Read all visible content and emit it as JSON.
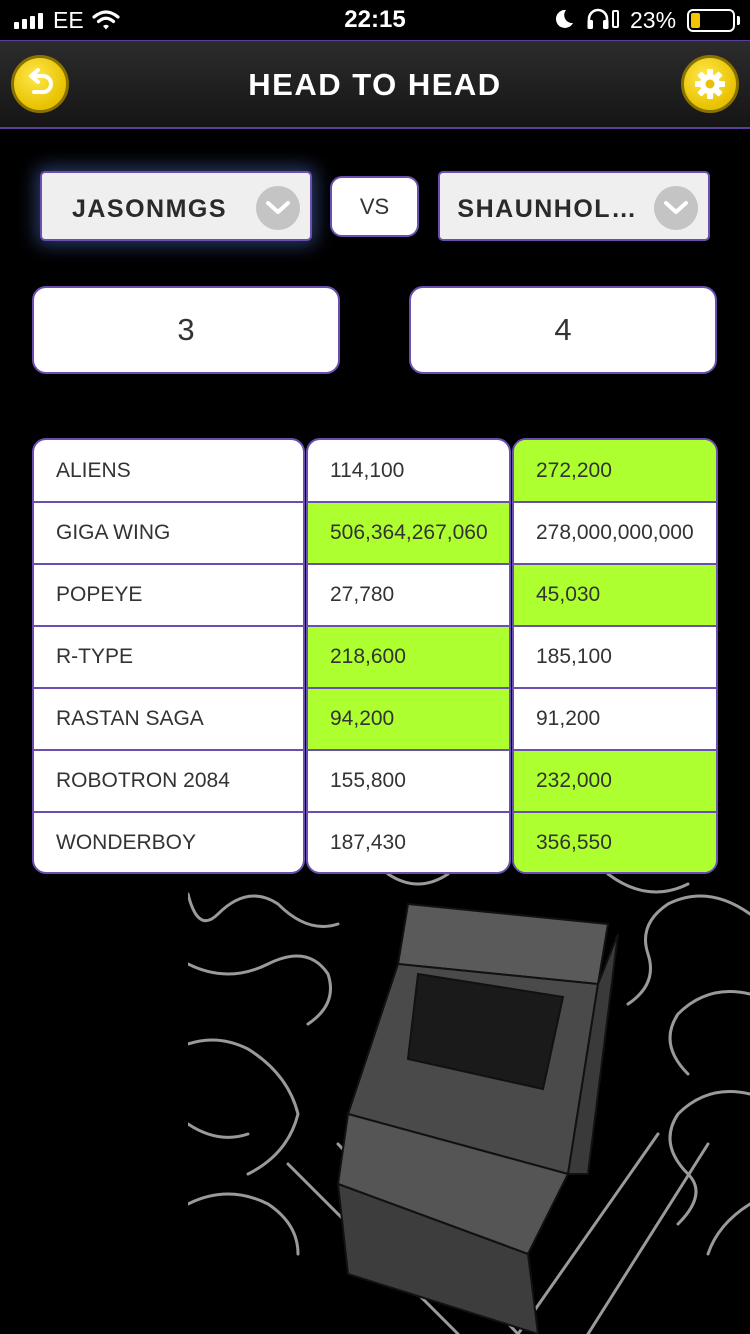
{
  "status_bar": {
    "carrier": "EE",
    "time": "22:15",
    "battery_percent_text": "23%",
    "battery_level": 0.23,
    "battery_color": "#f5c400"
  },
  "header": {
    "title": "HEAD TO HEAD",
    "back_icon": "undo-arrow-icon",
    "settings_icon": "gear-icon",
    "accent_color": "#f0d000"
  },
  "players": {
    "left": {
      "name": "JASONMGS",
      "wins": "3"
    },
    "vs_label": "VS",
    "right": {
      "name": "SHAUNHOL…",
      "wins": "4"
    }
  },
  "comparison": {
    "win_color": "#adff2f",
    "rows": [
      {
        "game": "ALIENS",
        "p1": "114,100",
        "p2": "272,200",
        "winner": "p2"
      },
      {
        "game": "GIGA WING",
        "p1": "506,364,267,060",
        "p2": "278,000,000,000",
        "winner": "p1"
      },
      {
        "game": "POPEYE",
        "p1": "27,780",
        "p2": "45,030",
        "winner": "p2"
      },
      {
        "game": "R-TYPE",
        "p1": "218,600",
        "p2": "185,100",
        "winner": "p1"
      },
      {
        "game": "RASTAN SAGA",
        "p1": "94,200",
        "p2": "91,200",
        "winner": "p1"
      },
      {
        "game": "ROBOTRON 2084",
        "p1": "155,800",
        "p2": "232,000",
        "winner": "p2"
      },
      {
        "game": "WONDERBOY",
        "p1": "187,430",
        "p2": "356,550",
        "winner": "p2"
      }
    ]
  }
}
